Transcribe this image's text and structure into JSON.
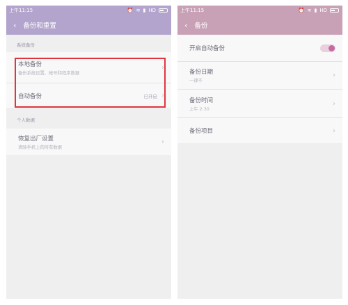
{
  "left": {
    "status": {
      "time": "上午11:15",
      "network": "HD"
    },
    "title": "备份和重置",
    "section_system": "系统备份",
    "local_backup": {
      "title": "本地备份",
      "subtitle": "备份系统设置、帐号和程序数据"
    },
    "auto_backup": {
      "title": "自动备份",
      "value": "已开启"
    },
    "section_personal": "个人数据",
    "factory_reset": {
      "title": "恢复出厂设置",
      "subtitle": "清除手机上的所有数据"
    }
  },
  "right": {
    "status": {
      "time": "上午11:15",
      "network": "HD"
    },
    "title": "备份",
    "auto_toggle": {
      "label": "开启自动备份",
      "on": true
    },
    "backup_date": {
      "title": "备份日期",
      "subtitle": "一律不"
    },
    "backup_time": {
      "title": "备份时间",
      "subtitle": "上午 2:30"
    },
    "backup_items": {
      "title": "备份项目"
    }
  },
  "colors": {
    "left_header": "#b2a4cc",
    "right_header": "#c9a1b7",
    "toggle_knob": "#c76aa4",
    "highlight": "#e0353f"
  }
}
